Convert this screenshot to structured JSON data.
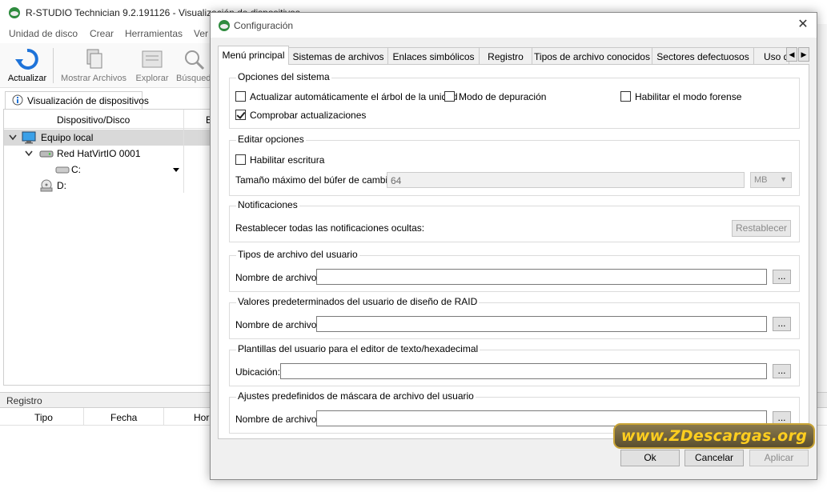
{
  "app": {
    "title": "R-STUDIO Technician 9.2.191126 - Visualización de dispositivos",
    "menu": [
      "Unidad de disco",
      "Crear",
      "Herramientas",
      "Ver"
    ],
    "toolbar": [
      "Actualizar",
      "Mostrar Archivos",
      "Explorar",
      "Búsqueda"
    ],
    "device_tab": "Visualización de dispositivos",
    "device_columns": [
      "Dispositivo/Disco",
      "B"
    ],
    "tree": [
      {
        "label": "Equipo local",
        "icon": "computer-icon"
      },
      {
        "label": "Red HatVirtIO 0001",
        "icon": "hard-disk-icon"
      },
      {
        "label": "C:",
        "icon": "drive-icon"
      },
      {
        "label": "D:",
        "icon": "cdrom-icon"
      }
    ],
    "log": {
      "title": "Registro",
      "columns": [
        "Tipo",
        "Fecha",
        "Hor"
      ]
    }
  },
  "dialog": {
    "title": "Configuración",
    "close_icon": "close-icon",
    "tabs": [
      "Menú principal",
      "Sistemas de archivos",
      "Enlaces simbólicos",
      "Registro",
      "Tipos de archivo conocidos",
      "Sectores defectuosos",
      "Uso d"
    ],
    "active_tab": "Menú principal",
    "system_options": {
      "title": "Opciones del sistema",
      "auto_update_tree": {
        "label": "Actualizar automáticamente el árbol de la unidad",
        "checked": false
      },
      "debug_mode": {
        "label": "Modo de depuración",
        "checked": false
      },
      "forensic_mode": {
        "label": "Habilitar el modo forense",
        "checked": false
      },
      "check_updates": {
        "label": "Comprobar actualizaciones",
        "checked": true
      }
    },
    "edit_options": {
      "title": "Editar opciones",
      "enable_write": {
        "label": "Habilitar escritura",
        "checked": false
      },
      "buffer_label": "Tamaño máximo del búfer de cambios:",
      "buffer_value": "64",
      "buffer_unit": "MB"
    },
    "notifications": {
      "title": "Notificaciones",
      "label": "Restablecer todas las notificaciones ocultas:",
      "button": "Restablecer"
    },
    "user_file_types": {
      "title": "Tipos de archivo del usuario",
      "label": "Nombre de archivo:",
      "value": "",
      "browse": "..."
    },
    "raid_defaults": {
      "title": "Valores predeterminados del usuario de diseño de RAID",
      "label": "Nombre de archivo:",
      "value": "",
      "browse": "..."
    },
    "hex_templates": {
      "title": "Plantillas del usuario para el editor de texto/hexadecimal",
      "label": "Ubicación:",
      "value": "",
      "browse": "..."
    },
    "mask_presets": {
      "title": "Ajustes predefinidos de máscara de archivo del usuario",
      "label": "Nombre de archivo:",
      "value": "",
      "browse": "..."
    },
    "buttons": {
      "ok": "Ok",
      "cancel": "Cancelar",
      "apply": "Aplicar"
    }
  },
  "watermark": "www.ZDescargas.org",
  "colors": {
    "dialog_bg": "#f0f0f0",
    "page_bg": "#ffffff",
    "accent_blue": "#1e73d9",
    "watermark_text": "#ffce1f",
    "watermark_bg": "#6e6240"
  }
}
